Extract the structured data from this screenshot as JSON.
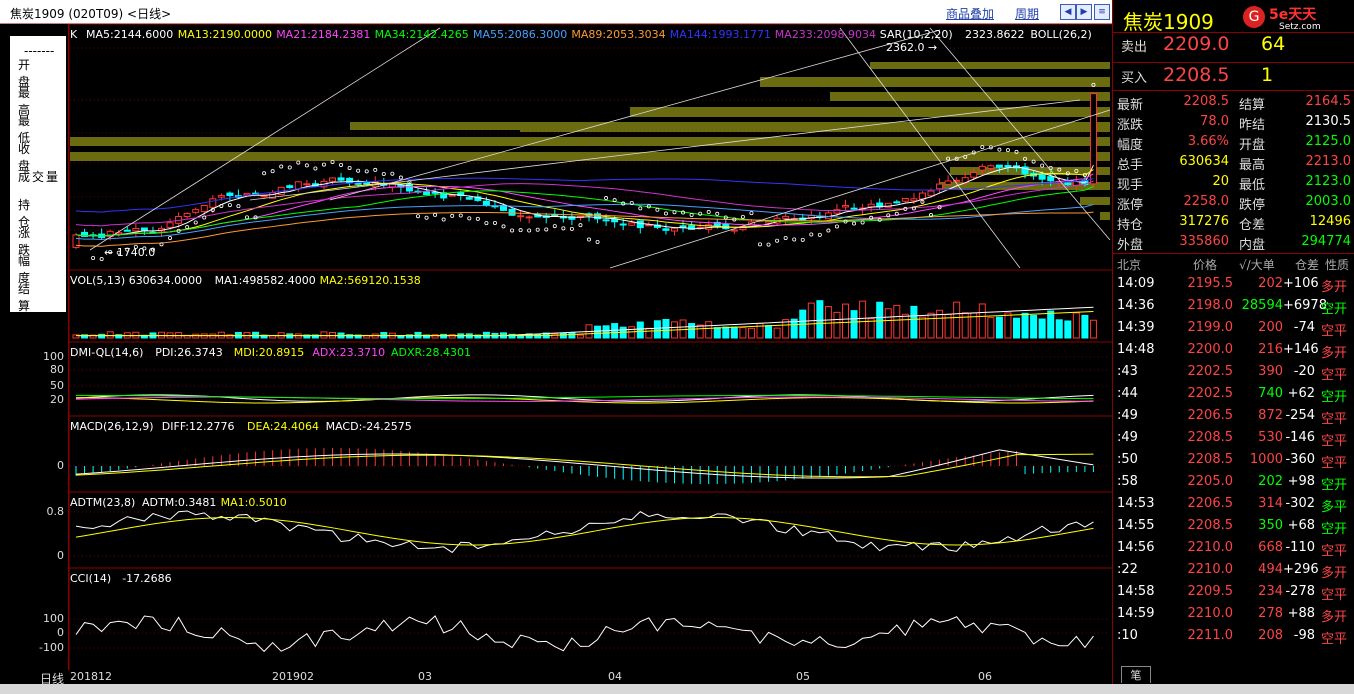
{
  "app": {
    "window_title": "焦炭1909 (020T09) <日线>",
    "menu_overlay": "商品叠加",
    "menu_period": "周期",
    "logo_text": "5e天天",
    "logo_sub": "Setz.com"
  },
  "left": {
    "fields": [
      "开盘",
      "最高",
      "最低",
      "收盘",
      "成交量",
      "持仓",
      "涨跌",
      "幅度",
      "结算"
    ],
    "price_ticks": [],
    "dmi_ticks": [
      "100",
      "80",
      "50",
      "20"
    ],
    "macd_ticks": [
      "0"
    ],
    "adtm_ticks": [
      "0.8",
      "0"
    ],
    "cci_ticks": [
      "100",
      "0",
      "-100"
    ],
    "period_label": "日线"
  },
  "panels": {
    "price": {
      "prefix": "K",
      "ma_labels": [
        {
          "text": "MA5:2144.6000",
          "color": "#ffffff"
        },
        {
          "text": "MA13:2190.0000",
          "color": "#ffff00"
        },
        {
          "text": "MA21:2184.2381",
          "color": "#ff44ff"
        },
        {
          "text": "MA34:2142.4265",
          "color": "#00ff00"
        },
        {
          "text": "MA55:2086.3000",
          "color": "#4aa0ff"
        },
        {
          "text": "MA89:2053.3034",
          "color": "#ff9933"
        },
        {
          "text": "MA144:1993.1771",
          "color": "#3333ff"
        },
        {
          "text": "MA233:2098.9034",
          "color": "#cc33cc"
        },
        {
          "text": "SAR(10,2,20)",
          "color": "#ffffff"
        },
        {
          "text": "2323.8622",
          "color": "#ffffff"
        },
        {
          "text": "BOLL(26,2)",
          "color": "#ffffff"
        }
      ],
      "high_mark": "2362.0",
      "low_mark": "1740.0"
    },
    "vol": {
      "labels": [
        {
          "text": "VOL(5,13) 630634.0000",
          "color": "#ffffff"
        },
        {
          "text": "MA1:498582.4000",
          "color": "#ffffff"
        },
        {
          "text": "MA2:569120.1538",
          "color": "#ffff00"
        }
      ]
    },
    "dmi": {
      "labels": [
        {
          "text": "DMI-QL(14,6)",
          "color": "#ffffff"
        },
        {
          "text": "PDI:26.3743",
          "color": "#ffffff"
        },
        {
          "text": "MDI:20.8915",
          "color": "#ffff00"
        },
        {
          "text": "ADX:23.3710",
          "color": "#ff44ff"
        },
        {
          "text": "ADXR:28.4301",
          "color": "#00ff00"
        }
      ]
    },
    "macd": {
      "labels": [
        {
          "text": "MACD(26,12,9)",
          "color": "#ffffff"
        },
        {
          "text": "DIFF:12.2776",
          "color": "#ffffff"
        },
        {
          "text": "DEA:24.4064",
          "color": "#ffff00"
        },
        {
          "text": "MACD:-24.2575",
          "color": "#ffffff"
        }
      ]
    },
    "adtm": {
      "labels": [
        {
          "text": "ADTM(23,8)",
          "color": "#ffffff"
        },
        {
          "text": "ADTM:0.3481",
          "color": "#ffffff"
        },
        {
          "text": "MA1:0.5010",
          "color": "#ffff00"
        }
      ]
    },
    "cci": {
      "labels": [
        {
          "text": "CCI(14)",
          "color": "#ffffff"
        },
        {
          "text": "-17.2686",
          "color": "#ffffff"
        }
      ]
    }
  },
  "x_axis": [
    "201812",
    "201902",
    "03",
    "04",
    "05",
    "06"
  ],
  "colors": {
    "up": "#ff3333",
    "down": "#00ffff",
    "grid": "#8b0000",
    "label": "#dddddd"
  },
  "quote": {
    "name": "焦炭1909",
    "ask_label": "卖出",
    "ask_price": "2209.0",
    "ask_vol": "64",
    "bid_label": "买入",
    "bid_price": "2208.5",
    "bid_vol": "1",
    "rows": [
      {
        "l1": "最新",
        "v1": "2208.5",
        "c1": "#ff4444",
        "l2": "结算",
        "v2": "2164.5",
        "c2": "#ff4444"
      },
      {
        "l1": "涨跌",
        "v1": "78.0",
        "c1": "#ff4444",
        "l2": "昨结",
        "v2": "2130.5",
        "c2": "#ffffff"
      },
      {
        "l1": "幅度",
        "v1": "3.66%",
        "c1": "#ff4444",
        "l2": "开盘",
        "v2": "2125.0",
        "c2": "#00ff00"
      },
      {
        "l1": "总手",
        "v1": "630634",
        "c1": "#ffff00",
        "l2": "最高",
        "v2": "2213.0",
        "c2": "#ff4444"
      },
      {
        "l1": "现手",
        "v1": "20",
        "c1": "#ffff00",
        "l2": "最低",
        "v2": "2123.0",
        "c2": "#00ff00"
      },
      {
        "l1": "涨停",
        "v1": "2258.0",
        "c1": "#ff4444",
        "l2": "跌停",
        "v2": "2003.0",
        "c2": "#00ff00"
      },
      {
        "l1": "持仓",
        "v1": "317276",
        "c1": "#ffff00",
        "l2": "仓差",
        "v2": "12496",
        "c2": "#ffff00"
      },
      {
        "l1": "外盘",
        "v1": "335860",
        "c1": "#ff4444",
        "l2": "内盘",
        "v2": "294774",
        "c2": "#00ff00"
      }
    ]
  },
  "ticks_header": {
    "time": "北京",
    "price": "价格",
    "size": "√/大单",
    "oi": "仓差",
    "nature": "性质"
  },
  "ticks": [
    {
      "time": "14:09",
      "price": "2195.5",
      "size": "202",
      "oi": "+106",
      "nature": "多开",
      "nc": "#ff4444"
    },
    {
      "time": "14:36",
      "price": "2198.0",
      "size": "28594",
      "oi": "+6978",
      "nature": "空开",
      "nc": "#00ff00"
    },
    {
      "time": "14:39",
      "price": "2199.0",
      "size": "200",
      "oi": "-74",
      "nature": "空平",
      "nc": "#ff4444"
    },
    {
      "time": "14:48",
      "price": "2200.0",
      "size": "216",
      "oi": "+146",
      "nature": "多开",
      "nc": "#ff4444"
    },
    {
      "time": ":43",
      "price": "2202.5",
      "size": "390",
      "oi": "-20",
      "nature": "空平",
      "nc": "#ff4444"
    },
    {
      "time": ":44",
      "price": "2202.5",
      "size": "740",
      "oi": "+62",
      "nature": "空开",
      "nc": "#00ff00"
    },
    {
      "time": ":49",
      "price": "2206.5",
      "size": "872",
      "oi": "-254",
      "nature": "空平",
      "nc": "#ff4444"
    },
    {
      "time": ":49",
      "price": "2208.5",
      "size": "530",
      "oi": "-146",
      "nature": "空平",
      "nc": "#ff4444"
    },
    {
      "time": ":50",
      "price": "2208.5",
      "size": "1000",
      "oi": "-360",
      "nature": "空平",
      "nc": "#ff4444"
    },
    {
      "time": ":58",
      "price": "2205.0",
      "size": "202",
      "oi": "+98",
      "nature": "空开",
      "nc": "#00ff00"
    },
    {
      "time": "14:53",
      "price": "2206.5",
      "size": "314",
      "oi": "-302",
      "nature": "多平",
      "nc": "#00ff00"
    },
    {
      "time": "14:55",
      "price": "2208.5",
      "size": "350",
      "oi": "+68",
      "nature": "空开",
      "nc": "#00ff00"
    },
    {
      "time": "14:56",
      "price": "2210.0",
      "size": "668",
      "oi": "-110",
      "nature": "空平",
      "nc": "#ff4444"
    },
    {
      "time": ":22",
      "price": "2210.0",
      "size": "494",
      "oi": "+296",
      "nature": "多开",
      "nc": "#ff4444"
    },
    {
      "time": "14:58",
      "price": "2209.5",
      "size": "234",
      "oi": "-278",
      "nature": "空平",
      "nc": "#ff4444"
    },
    {
      "time": "14:59",
      "price": "2210.0",
      "size": "278",
      "oi": "+88",
      "nature": "多开",
      "nc": "#ff4444"
    },
    {
      "time": ":10",
      "price": "2211.0",
      "size": "208",
      "oi": "-98",
      "nature": "空平",
      "nc": "#ff4444"
    }
  ],
  "bottom_tab": "笔"
}
